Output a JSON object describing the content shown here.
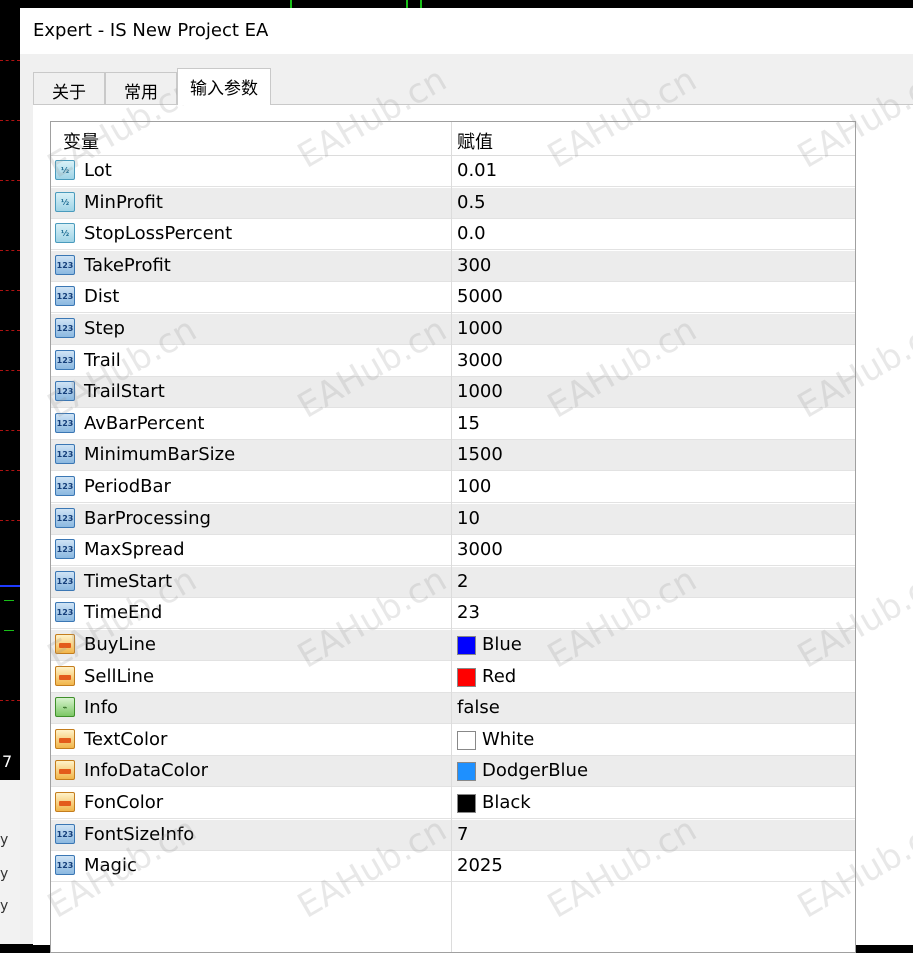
{
  "window": {
    "title": "Expert - IS New Project EA"
  },
  "tabs": [
    {
      "label": "关于",
      "active": false
    },
    {
      "label": "常用",
      "active": false
    },
    {
      "label": "输入参数",
      "active": true
    }
  ],
  "table": {
    "columns": [
      "变量",
      "赋值"
    ],
    "rows": [
      {
        "icon": "double-param-icon",
        "name": "Lot",
        "value": "0.01"
      },
      {
        "icon": "double-param-icon",
        "name": "MinProfit",
        "value": "0.5"
      },
      {
        "icon": "double-param-icon",
        "name": "StopLossPercent",
        "value": "0.0"
      },
      {
        "icon": "int-param-icon",
        "name": "TakeProfit",
        "value": "300"
      },
      {
        "icon": "int-param-icon",
        "name": "Dist",
        "value": "5000"
      },
      {
        "icon": "int-param-icon",
        "name": "Step",
        "value": "1000"
      },
      {
        "icon": "int-param-icon",
        "name": "Trail",
        "value": "3000"
      },
      {
        "icon": "int-param-icon",
        "name": "TrailStart",
        "value": "1000"
      },
      {
        "icon": "int-param-icon",
        "name": "AvBarPercent",
        "value": "15"
      },
      {
        "icon": "int-param-icon",
        "name": "MinimumBarSize",
        "value": "1500"
      },
      {
        "icon": "int-param-icon",
        "name": "PeriodBar",
        "value": "100"
      },
      {
        "icon": "int-param-icon",
        "name": "BarProcessing",
        "value": "10"
      },
      {
        "icon": "int-param-icon",
        "name": "MaxSpread",
        "value": "3000"
      },
      {
        "icon": "int-param-icon",
        "name": "TimeStart",
        "value": "2"
      },
      {
        "icon": "int-param-icon",
        "name": "TimeEnd",
        "value": "23"
      },
      {
        "icon": "color-param-icon",
        "name": "BuyLine",
        "value": "Blue",
        "swatch": "#0000ff"
      },
      {
        "icon": "color-param-icon",
        "name": "SellLine",
        "value": "Red",
        "swatch": "#ff0000"
      },
      {
        "icon": "bool-param-icon",
        "name": "Info",
        "value": "false"
      },
      {
        "icon": "color-param-icon",
        "name": "TextColor",
        "value": "White",
        "swatch": "#ffffff"
      },
      {
        "icon": "color-param-icon",
        "name": "InfoDataColor",
        "value": "DodgerBlue",
        "swatch": "#1e90ff"
      },
      {
        "icon": "color-param-icon",
        "name": "FonColor",
        "value": "Black",
        "swatch": "#000000"
      },
      {
        "icon": "int-param-icon",
        "name": "FontSizeInfo",
        "value": "7"
      },
      {
        "icon": "int-param-icon",
        "name": "Magic",
        "value": "2025"
      }
    ]
  },
  "watermark": "EAHub.cn",
  "chart_behind": {
    "left_label": "7",
    "y_labels": [
      "y",
      "y",
      "y"
    ]
  }
}
